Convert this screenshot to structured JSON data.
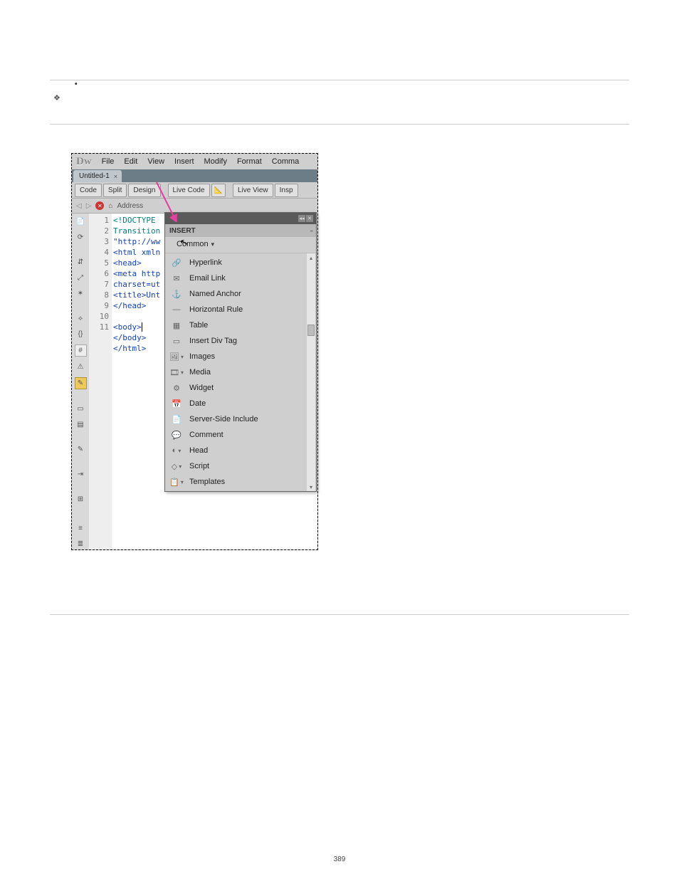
{
  "bullets": [
    {
      "text": ""
    },
    {
      "text": ""
    },
    {
      "text": ""
    },
    {
      "text": ""
    }
  ],
  "diamond_text": "",
  "section_body": "",
  "page_number": "389",
  "menubar": {
    "logo": "Dw",
    "items": [
      "File",
      "Edit",
      "View",
      "Insert",
      "Modify",
      "Format",
      "Comma"
    ]
  },
  "doc_tab": {
    "label": "Untitled-1",
    "close": "×"
  },
  "toolbar": {
    "code": "Code",
    "split": "Split",
    "design": "Design",
    "live_code": "Live Code",
    "live_view": "Live View",
    "insp": "Insp"
  },
  "addrbar": {
    "label": "Address"
  },
  "code_lines": {
    "l1": "<!DOCTYPE",
    "l1b": "Transition",
    "l1c": "\"http://ww",
    "l2": "<html xmln",
    "l3": "<head>",
    "l4": "<meta http",
    "l4b": "charset=ut",
    "l5": "<title>Unt",
    "l6": "</head>",
    "l7": "",
    "l8": "<body>",
    "l9": "</body>",
    "l10": "</html>"
  },
  "gutter_nums": [
    "1",
    "",
    "",
    "2",
    "3",
    "4",
    "",
    "5",
    "6",
    "7",
    "8",
    "9",
    "10",
    "11"
  ],
  "insert_panel": {
    "title": "INSERT",
    "dropdown": "Common",
    "items": [
      {
        "icon": "🔗",
        "label": "Hyperlink"
      },
      {
        "icon": "✉",
        "label": "Email Link"
      },
      {
        "icon": "⚓",
        "label": "Named Anchor"
      },
      {
        "icon": "—",
        "label": "Horizontal Rule"
      },
      {
        "icon": "▦",
        "label": "Table"
      },
      {
        "icon": "▭",
        "label": "Insert Div Tag"
      },
      {
        "icon": "🖼",
        "label": "Images",
        "dd": true
      },
      {
        "icon": "🎞",
        "label": "Media",
        "dd": true
      },
      {
        "icon": "⚙",
        "label": "Widget"
      },
      {
        "icon": "📅",
        "label": "Date"
      },
      {
        "icon": "📄",
        "label": "Server-Side Include"
      },
      {
        "icon": "💬",
        "label": "Comment"
      },
      {
        "icon": "◐",
        "label": "Head",
        "dd": true
      },
      {
        "icon": "◇",
        "label": "Script",
        "dd": true
      },
      {
        "icon": "📋",
        "label": "Templates",
        "dd": true
      }
    ]
  }
}
